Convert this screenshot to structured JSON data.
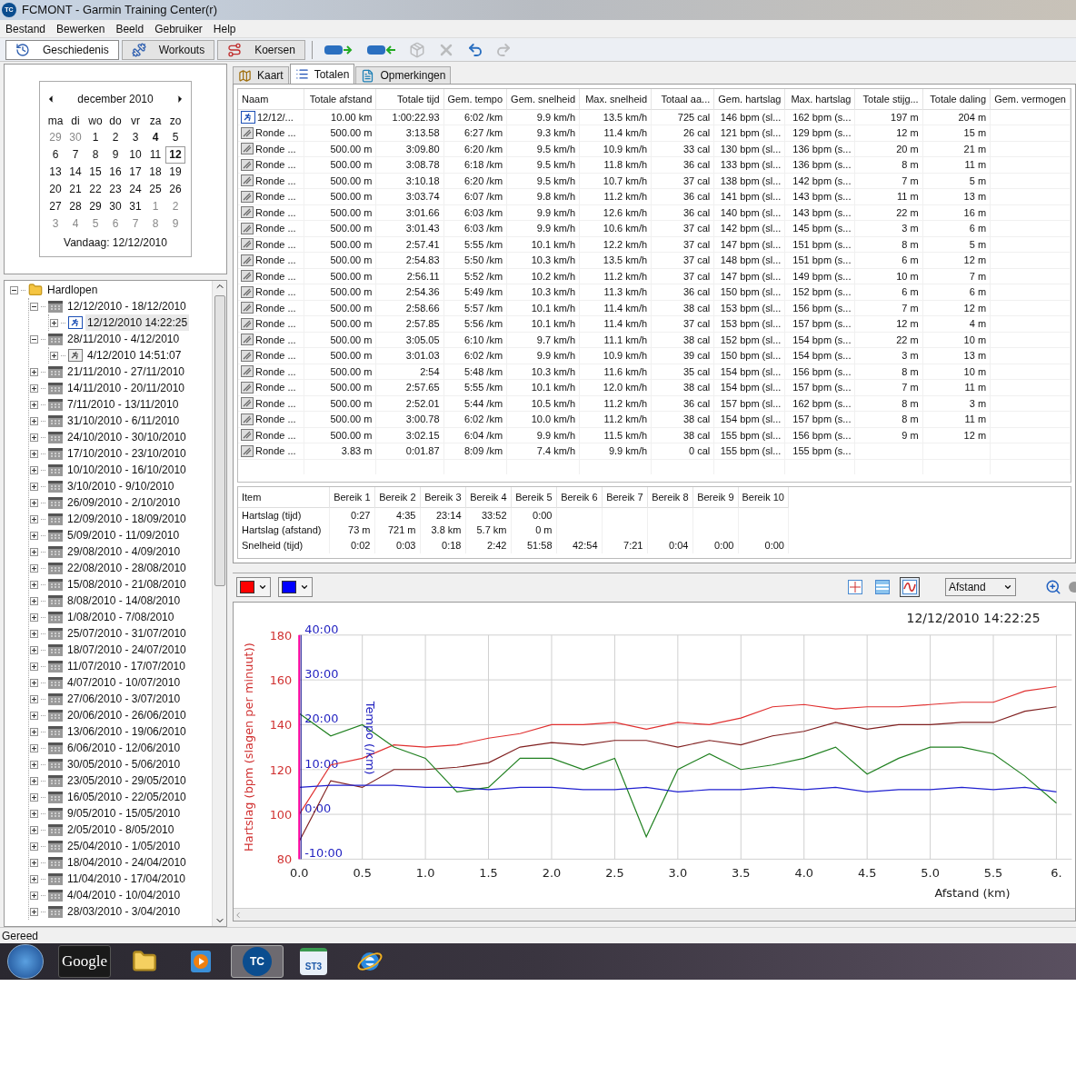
{
  "window": {
    "icon_text": "TC",
    "title": "FCMONT - Garmin Training Center(r)"
  },
  "menu": [
    "Bestand",
    "Bewerken",
    "Beeld",
    "Gebruiker",
    "Help"
  ],
  "toolbar": {
    "buttons": [
      {
        "label": "Geschiedenis",
        "kind": "history",
        "selected": true
      },
      {
        "label": "Workouts",
        "kind": "workouts",
        "selected": false
      },
      {
        "label": "Koersen",
        "kind": "courses",
        "selected": false
      }
    ],
    "icons": [
      {
        "kind": "send",
        "disabled": false
      },
      {
        "kind": "receive",
        "disabled": false
      },
      {
        "kind": "import",
        "disabled": true
      },
      {
        "kind": "delete",
        "disabled": true
      },
      {
        "kind": "undo",
        "disabled": false
      },
      {
        "kind": "redo",
        "disabled": true
      }
    ]
  },
  "calendar": {
    "month": "december 2010",
    "weekdays": [
      "ma",
      "di",
      "wo",
      "do",
      "vr",
      "za",
      "zo"
    ],
    "weeks": [
      [
        {
          "d": "29",
          "muted": true,
          "bold": false,
          "selected": false
        },
        {
          "d": "30",
          "muted": true,
          "bold": false,
          "selected": false
        },
        {
          "d": "1",
          "muted": false,
          "bold": false,
          "selected": false
        },
        {
          "d": "2",
          "muted": false,
          "bold": false,
          "selected": false
        },
        {
          "d": "3",
          "muted": false,
          "bold": false,
          "selected": false
        },
        {
          "d": "4",
          "muted": false,
          "bold": true,
          "selected": false
        },
        {
          "d": "5",
          "muted": false,
          "bold": false,
          "selected": false
        }
      ],
      [
        {
          "d": "6",
          "muted": false,
          "bold": false,
          "selected": false
        },
        {
          "d": "7",
          "muted": false,
          "bold": false,
          "selected": false
        },
        {
          "d": "8",
          "muted": false,
          "bold": false,
          "selected": false
        },
        {
          "d": "9",
          "muted": false,
          "bold": false,
          "selected": false
        },
        {
          "d": "10",
          "muted": false,
          "bold": false,
          "selected": false
        },
        {
          "d": "11",
          "muted": false,
          "bold": false,
          "selected": false
        },
        {
          "d": "12",
          "muted": false,
          "bold": true,
          "selected": true
        }
      ],
      [
        {
          "d": "13",
          "muted": false,
          "bold": false,
          "selected": false
        },
        {
          "d": "14",
          "muted": false,
          "bold": false,
          "selected": false
        },
        {
          "d": "15",
          "muted": false,
          "bold": false,
          "selected": false
        },
        {
          "d": "16",
          "muted": false,
          "bold": false,
          "selected": false
        },
        {
          "d": "17",
          "muted": false,
          "bold": false,
          "selected": false
        },
        {
          "d": "18",
          "muted": false,
          "bold": false,
          "selected": false
        },
        {
          "d": "19",
          "muted": false,
          "bold": false,
          "selected": false
        }
      ],
      [
        {
          "d": "20",
          "muted": false,
          "bold": false,
          "selected": false
        },
        {
          "d": "21",
          "muted": false,
          "bold": false,
          "selected": false
        },
        {
          "d": "22",
          "muted": false,
          "bold": false,
          "selected": false
        },
        {
          "d": "23",
          "muted": false,
          "bold": false,
          "selected": false
        },
        {
          "d": "24",
          "muted": false,
          "bold": false,
          "selected": false
        },
        {
          "d": "25",
          "muted": false,
          "bold": false,
          "selected": false
        },
        {
          "d": "26",
          "muted": false,
          "bold": false,
          "selected": false
        }
      ],
      [
        {
          "d": "27",
          "muted": false,
          "bold": false,
          "selected": false
        },
        {
          "d": "28",
          "muted": false,
          "bold": false,
          "selected": false
        },
        {
          "d": "29",
          "muted": false,
          "bold": false,
          "selected": false
        },
        {
          "d": "30",
          "muted": false,
          "bold": false,
          "selected": false
        },
        {
          "d": "31",
          "muted": false,
          "bold": false,
          "selected": false
        },
        {
          "d": "1",
          "muted": true,
          "bold": false,
          "selected": false
        },
        {
          "d": "2",
          "muted": true,
          "bold": false,
          "selected": false
        }
      ],
      [
        {
          "d": "3",
          "muted": true,
          "bold": false,
          "selected": false
        },
        {
          "d": "4",
          "muted": true,
          "bold": false,
          "selected": false
        },
        {
          "d": "5",
          "muted": true,
          "bold": false,
          "selected": false
        },
        {
          "d": "6",
          "muted": true,
          "bold": false,
          "selected": false
        },
        {
          "d": "7",
          "muted": true,
          "bold": false,
          "selected": false
        },
        {
          "d": "8",
          "muted": true,
          "bold": false,
          "selected": false
        },
        {
          "d": "9",
          "muted": true,
          "bold": false,
          "selected": false
        }
      ]
    ],
    "today": "Vandaag: 12/12/2010"
  },
  "tree": [
    {
      "label": "Hardlopen",
      "kind": "folder",
      "expanded": true,
      "selected": false,
      "children": [
        {
          "label": "12/12/2010 - 18/12/2010",
          "kind": "week",
          "expanded": true,
          "selected": false,
          "children": [
            {
              "label": "12/12/2010 14:22:25",
              "kind": "activity",
              "expanded": false,
              "selected": true
            }
          ]
        },
        {
          "label": "28/11/2010 - 4/12/2010",
          "kind": "week",
          "expanded": true,
          "selected": false,
          "children": [
            {
              "label": "4/12/2010 14:51:07",
              "kind": "activity",
              "expanded": false,
              "selected": false
            }
          ]
        },
        {
          "label": "21/11/2010 - 27/11/2010",
          "kind": "week",
          "expanded": false,
          "selected": false
        },
        {
          "label": "14/11/2010 - 20/11/2010",
          "kind": "week",
          "expanded": false,
          "selected": false
        },
        {
          "label": "7/11/2010 - 13/11/2010",
          "kind": "week",
          "expanded": false,
          "selected": false
        },
        {
          "label": "31/10/2010 - 6/11/2010",
          "kind": "week",
          "expanded": false,
          "selected": false
        },
        {
          "label": "24/10/2010 - 30/10/2010",
          "kind": "week",
          "expanded": false,
          "selected": false
        },
        {
          "label": "17/10/2010 - 23/10/2010",
          "kind": "week",
          "expanded": false,
          "selected": false
        },
        {
          "label": "10/10/2010 - 16/10/2010",
          "kind": "week",
          "expanded": false,
          "selected": false
        },
        {
          "label": "3/10/2010 - 9/10/2010",
          "kind": "week",
          "expanded": false,
          "selected": false
        },
        {
          "label": "26/09/2010 - 2/10/2010",
          "kind": "week",
          "expanded": false,
          "selected": false
        },
        {
          "label": "12/09/2010 - 18/09/2010",
          "kind": "week",
          "expanded": false,
          "selected": false
        },
        {
          "label": "5/09/2010 - 11/09/2010",
          "kind": "week",
          "expanded": false,
          "selected": false
        },
        {
          "label": "29/08/2010 - 4/09/2010",
          "kind": "week",
          "expanded": false,
          "selected": false
        },
        {
          "label": "22/08/2010 - 28/08/2010",
          "kind": "week",
          "expanded": false,
          "selected": false
        },
        {
          "label": "15/08/2010 - 21/08/2010",
          "kind": "week",
          "expanded": false,
          "selected": false
        },
        {
          "label": "8/08/2010 - 14/08/2010",
          "kind": "week",
          "expanded": false,
          "selected": false
        },
        {
          "label": "1/08/2010 - 7/08/2010",
          "kind": "week",
          "expanded": false,
          "selected": false
        },
        {
          "label": "25/07/2010 - 31/07/2010",
          "kind": "week",
          "expanded": false,
          "selected": false
        },
        {
          "label": "18/07/2010 - 24/07/2010",
          "kind": "week",
          "expanded": false,
          "selected": false
        },
        {
          "label": "11/07/2010 - 17/07/2010",
          "kind": "week",
          "expanded": false,
          "selected": false
        },
        {
          "label": "4/07/2010 - 10/07/2010",
          "kind": "week",
          "expanded": false,
          "selected": false
        },
        {
          "label": "27/06/2010 - 3/07/2010",
          "kind": "week",
          "expanded": false,
          "selected": false
        },
        {
          "label": "20/06/2010 - 26/06/2010",
          "kind": "week",
          "expanded": false,
          "selected": false
        },
        {
          "label": "13/06/2010 - 19/06/2010",
          "kind": "week",
          "expanded": false,
          "selected": false
        },
        {
          "label": "6/06/2010 - 12/06/2010",
          "kind": "week",
          "expanded": false,
          "selected": false
        },
        {
          "label": "30/05/2010 - 5/06/2010",
          "kind": "week",
          "expanded": false,
          "selected": false
        },
        {
          "label": "23/05/2010 - 29/05/2010",
          "kind": "week",
          "expanded": false,
          "selected": false
        },
        {
          "label": "16/05/2010 - 22/05/2010",
          "kind": "week",
          "expanded": false,
          "selected": false
        },
        {
          "label": "9/05/2010 - 15/05/2010",
          "kind": "week",
          "expanded": false,
          "selected": false
        },
        {
          "label": "2/05/2010 - 8/05/2010",
          "kind": "week",
          "expanded": false,
          "selected": false
        },
        {
          "label": "25/04/2010 - 1/05/2010",
          "kind": "week",
          "expanded": false,
          "selected": false
        },
        {
          "label": "18/04/2010 - 24/04/2010",
          "kind": "week",
          "expanded": false,
          "selected": false
        },
        {
          "label": "11/04/2010 - 17/04/2010",
          "kind": "week",
          "expanded": false,
          "selected": false
        },
        {
          "label": "4/04/2010 - 10/04/2010",
          "kind": "week",
          "expanded": false,
          "selected": false
        },
        {
          "label": "28/03/2010 - 3/04/2010",
          "kind": "week",
          "expanded": false,
          "selected": false
        }
      ]
    }
  ],
  "tabs": [
    {
      "label": "Kaart",
      "kind": "map",
      "selected": false
    },
    {
      "label": "Totalen",
      "kind": "list",
      "selected": true
    },
    {
      "label": "Opmerkingen",
      "kind": "notes",
      "selected": false
    }
  ],
  "totals_table": {
    "columns": [
      "Naam",
      "Totale afstand",
      "Totale tijd",
      "Gem. tempo",
      "Gem. snelheid",
      "Max. snelheid",
      "Totaal aa...",
      "Gem. hartslag",
      "Max. hartslag",
      "Totale stijg...",
      "Totale daling",
      "Gem. vermogen"
    ],
    "rows": [
      {
        "kind": "activity",
        "cells": [
          "12/12/...",
          "10.00 km",
          "1:00:22.93",
          "6:02 /km",
          "9.9 km/h",
          "13.5 km/h",
          "725 cal",
          "146 bpm (sl...",
          "162 bpm (s...",
          "197 m",
          "204 m"
        ]
      },
      {
        "kind": "lap",
        "cells": [
          "Ronde ...",
          "500.00 m",
          "3:13.58",
          "6:27 /km",
          "9.3 km/h",
          "11.4 km/h",
          "26 cal",
          "121 bpm (sl...",
          "129 bpm (s...",
          "12 m",
          "15 m"
        ]
      },
      {
        "kind": "lap",
        "cells": [
          "Ronde ...",
          "500.00 m",
          "3:09.80",
          "6:20 /km",
          "9.5 km/h",
          "10.9 km/h",
          "33 cal",
          "130 bpm (sl...",
          "136 bpm (s...",
          "20 m",
          "21 m"
        ]
      },
      {
        "kind": "lap",
        "cells": [
          "Ronde ...",
          "500.00 m",
          "3:08.78",
          "6:18 /km",
          "9.5 km/h",
          "11.8 km/h",
          "36 cal",
          "133 bpm (sl...",
          "136 bpm (s...",
          "8 m",
          "11 m"
        ]
      },
      {
        "kind": "lap",
        "cells": [
          "Ronde ...",
          "500.00 m",
          "3:10.18",
          "6:20 /km",
          "9.5 km/h",
          "10.7 km/h",
          "37 cal",
          "138 bpm (sl...",
          "142 bpm (s...",
          "7 m",
          "5 m"
        ]
      },
      {
        "kind": "lap",
        "cells": [
          "Ronde ...",
          "500.00 m",
          "3:03.74",
          "6:07 /km",
          "9.8 km/h",
          "11.2 km/h",
          "36 cal",
          "141 bpm (sl...",
          "143 bpm (s...",
          "11 m",
          "13 m"
        ]
      },
      {
        "kind": "lap",
        "cells": [
          "Ronde ...",
          "500.00 m",
          "3:01.66",
          "6:03 /km",
          "9.9 km/h",
          "12.6 km/h",
          "36 cal",
          "140 bpm (sl...",
          "143 bpm (s...",
          "22 m",
          "16 m"
        ]
      },
      {
        "kind": "lap",
        "cells": [
          "Ronde ...",
          "500.00 m",
          "3:01.43",
          "6:03 /km",
          "9.9 km/h",
          "10.6 km/h",
          "37 cal",
          "142 bpm (sl...",
          "145 bpm (s...",
          "3 m",
          "6 m"
        ]
      },
      {
        "kind": "lap",
        "cells": [
          "Ronde ...",
          "500.00 m",
          "2:57.41",
          "5:55 /km",
          "10.1 km/h",
          "12.2 km/h",
          "37 cal",
          "147 bpm (sl...",
          "151 bpm (s...",
          "8 m",
          "5 m"
        ]
      },
      {
        "kind": "lap",
        "cells": [
          "Ronde ...",
          "500.00 m",
          "2:54.83",
          "5:50 /km",
          "10.3 km/h",
          "13.5 km/h",
          "37 cal",
          "148 bpm (sl...",
          "151 bpm (s...",
          "6 m",
          "12 m"
        ]
      },
      {
        "kind": "lap",
        "cells": [
          "Ronde ...",
          "500.00 m",
          "2:56.11",
          "5:52 /km",
          "10.2 km/h",
          "11.2 km/h",
          "37 cal",
          "147 bpm (sl...",
          "149 bpm (s...",
          "10 m",
          "7 m"
        ]
      },
      {
        "kind": "lap",
        "cells": [
          "Ronde ...",
          "500.00 m",
          "2:54.36",
          "5:49 /km",
          "10.3 km/h",
          "11.3 km/h",
          "36 cal",
          "150 bpm (sl...",
          "152 bpm (s...",
          "6 m",
          "6 m"
        ]
      },
      {
        "kind": "lap",
        "cells": [
          "Ronde ...",
          "500.00 m",
          "2:58.66",
          "5:57 /km",
          "10.1 km/h",
          "11.4 km/h",
          "38 cal",
          "153 bpm (sl...",
          "156 bpm (s...",
          "7 m",
          "12 m"
        ]
      },
      {
        "kind": "lap",
        "cells": [
          "Ronde ...",
          "500.00 m",
          "2:57.85",
          "5:56 /km",
          "10.1 km/h",
          "11.4 km/h",
          "37 cal",
          "153 bpm (sl...",
          "157 bpm (s...",
          "12 m",
          "4 m"
        ]
      },
      {
        "kind": "lap",
        "cells": [
          "Ronde ...",
          "500.00 m",
          "3:05.05",
          "6:10 /km",
          "9.7 km/h",
          "11.1 km/h",
          "38 cal",
          "152 bpm (sl...",
          "154 bpm (s...",
          "22 m",
          "10 m"
        ]
      },
      {
        "kind": "lap",
        "cells": [
          "Ronde ...",
          "500.00 m",
          "3:01.03",
          "6:02 /km",
          "9.9 km/h",
          "10.9 km/h",
          "39 cal",
          "150 bpm (sl...",
          "154 bpm (s...",
          "3 m",
          "13 m"
        ]
      },
      {
        "kind": "lap",
        "cells": [
          "Ronde ...",
          "500.00 m",
          "2:54",
          "5:48 /km",
          "10.3 km/h",
          "11.6 km/h",
          "35 cal",
          "154 bpm (sl...",
          "156 bpm (s...",
          "8 m",
          "10 m"
        ]
      },
      {
        "kind": "lap",
        "cells": [
          "Ronde ...",
          "500.00 m",
          "2:57.65",
          "5:55 /km",
          "10.1 km/h",
          "12.0 km/h",
          "38 cal",
          "154 bpm (sl...",
          "157 bpm (s...",
          "7 m",
          "11 m"
        ]
      },
      {
        "kind": "lap",
        "cells": [
          "Ronde ...",
          "500.00 m",
          "2:52.01",
          "5:44 /km",
          "10.5 km/h",
          "11.2 km/h",
          "36 cal",
          "157 bpm (sl...",
          "162 bpm (s...",
          "8 m",
          "3 m"
        ]
      },
      {
        "kind": "lap",
        "cells": [
          "Ronde ...",
          "500.00 m",
          "3:00.78",
          "6:02 /km",
          "10.0 km/h",
          "11.2 km/h",
          "38 cal",
          "154 bpm (sl...",
          "157 bpm (s...",
          "8 m",
          "11 m"
        ]
      },
      {
        "kind": "lap",
        "cells": [
          "Ronde ...",
          "500.00 m",
          "3:02.15",
          "6:04 /km",
          "9.9 km/h",
          "11.5 km/h",
          "38 cal",
          "155 bpm (sl...",
          "156 bpm (s...",
          "9 m",
          "12 m"
        ]
      },
      {
        "kind": "lap",
        "cells": [
          "Ronde ...",
          "3.83 m",
          "0:01.87",
          "8:09 /km",
          "7.4 km/h",
          "9.9 km/h",
          "0 cal",
          "155 bpm (sl...",
          "155 bpm (s..."
        ]
      }
    ]
  },
  "zones_table": {
    "columns": [
      "Item",
      "Bereik 1",
      "Bereik 2",
      "Bereik 3",
      "Bereik 4",
      "Bereik 5",
      "Bereik 6",
      "Bereik 7",
      "Bereik 8",
      "Bereik 9",
      "Bereik 10"
    ],
    "rows": [
      [
        "Hartslag (tijd)",
        "0:27",
        "4:35",
        "23:14",
        "33:52",
        "0:00"
      ],
      [
        "Hartslag (afstand)",
        "73 m",
        "721 m",
        "3.8 km",
        "5.7 km",
        "0 m"
      ],
      [
        "Snelheid (tijd)",
        "0:02",
        "0:03",
        "0:18",
        "2:42",
        "51:58",
        "42:54",
        "7:21",
        "0:04",
        "0:00",
        "0:00"
      ]
    ]
  },
  "chart_toolbar": {
    "color_pickers": [
      {
        "color": "#ff0000"
      },
      {
        "color": "#0000ff"
      }
    ],
    "views": [
      {
        "kind": "crosshair",
        "selected": false
      },
      {
        "kind": "bands",
        "selected": false
      },
      {
        "kind": "curve",
        "selected": true
      }
    ],
    "x_axis_select": "Afstand"
  },
  "chart": {
    "timestamp": "12/12/2010 14:22:25",
    "tempo_axis": {
      "label": "Tempo (/km)",
      "ticks": [
        "40:00",
        "30:00",
        "20:00",
        "10:00",
        "0:00",
        "-10:00"
      ]
    },
    "chart_data": {
      "type": "line",
      "xlabel": "Afstand (km)",
      "ylabel": "Hartslag (bpm (slagen per minuut))",
      "x": [
        0,
        0.25,
        0.5,
        0.75,
        1,
        1.25,
        1.5,
        1.75,
        2,
        2.25,
        2.5,
        2.75,
        3,
        3.25,
        3.5,
        3.75,
        4,
        4.25,
        4.5,
        4.75,
        5,
        5.25,
        5.5,
        5.75,
        6
      ],
      "series": [
        {
          "color": "#e03030",
          "values": [
            100,
            122,
            125,
            131,
            130,
            131,
            134,
            136,
            140,
            140,
            141,
            138,
            141,
            140,
            143,
            148,
            149,
            147,
            148,
            148,
            149,
            150,
            150,
            155,
            157
          ]
        },
        {
          "color": "#802020",
          "values": [
            88,
            115,
            112,
            120,
            120,
            121,
            123,
            130,
            132,
            131,
            133,
            133,
            130,
            133,
            131,
            135,
            137,
            141,
            138,
            140,
            140,
            141,
            141,
            146,
            148
          ]
        },
        {
          "color": "#208020",
          "values": [
            145,
            135,
            140,
            130,
            125,
            110,
            112,
            125,
            125,
            120,
            125,
            90,
            120,
            127,
            120,
            122,
            125,
            130,
            118,
            125,
            130,
            130,
            127,
            117,
            105
          ]
        },
        {
          "color": "#2020d0",
          "values": [
            112,
            113,
            113,
            113,
            112,
            112,
            111,
            112,
            112,
            111,
            111,
            112,
            110,
            111,
            111,
            112,
            111,
            112,
            110,
            111,
            111,
            112,
            111,
            112,
            110
          ]
        }
      ],
      "xlim": [
        0,
        6
      ],
      "ylim": [
        80,
        180
      ],
      "grid": true,
      "xticks": [
        {
          "value": 0,
          "label": "0.0"
        },
        {
          "value": 0.5,
          "label": "0.5"
        },
        {
          "value": 1,
          "label": "1.0"
        },
        {
          "value": 1.5,
          "label": "1.5"
        },
        {
          "value": 2,
          "label": "2.0"
        },
        {
          "value": 2.5,
          "label": "2.5"
        },
        {
          "value": 3,
          "label": "3.0"
        },
        {
          "value": 3.5,
          "label": "3.5"
        },
        {
          "value": 4,
          "label": "4.0"
        },
        {
          "value": 4.5,
          "label": "4.5"
        },
        {
          "value": 5,
          "label": "5.0"
        },
        {
          "value": 5.5,
          "label": "5.5"
        },
        {
          "value": 6,
          "label": "6."
        }
      ],
      "yticks": [
        80,
        100,
        120,
        140,
        160,
        180
      ]
    }
  },
  "status_bar": "Gereed",
  "taskbar": [
    {
      "kind": "start",
      "selected": false
    },
    {
      "kind": "google",
      "label": "Google",
      "selected": false
    },
    {
      "kind": "folder",
      "selected": false
    },
    {
      "kind": "media",
      "selected": false
    },
    {
      "kind": "tc",
      "label": "TC",
      "selected": true
    },
    {
      "kind": "st3",
      "label": "ST3",
      "selected": false
    },
    {
      "kind": "ie",
      "selected": false
    }
  ]
}
